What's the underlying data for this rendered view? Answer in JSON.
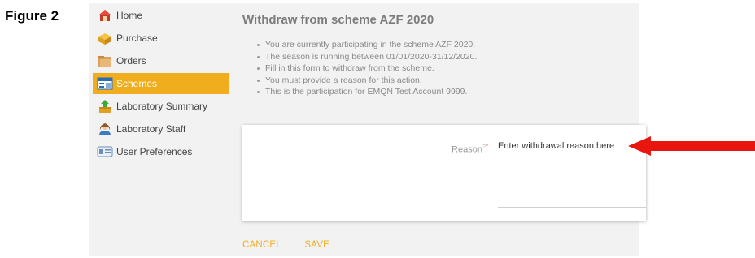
{
  "figure_label": "Figure 2",
  "sidebar": {
    "items": [
      {
        "label": "Home",
        "icon": "home-icon",
        "active": false
      },
      {
        "label": "Purchase",
        "icon": "purchase-box-icon",
        "active": false
      },
      {
        "label": "Orders",
        "icon": "orders-folder-icon",
        "active": false
      },
      {
        "label": "Schemes",
        "icon": "schemes-window-icon",
        "active": true
      },
      {
        "label": "Laboratory Summary",
        "icon": "laboratory-summary-icon",
        "active": false
      },
      {
        "label": "Laboratory Staff",
        "icon": "staff-person-icon",
        "active": false
      },
      {
        "label": "User Preferences",
        "icon": "preferences-card-icon",
        "active": false
      }
    ]
  },
  "main": {
    "title": "Withdraw from scheme AZF 2020",
    "info": [
      "You are currently participating in the scheme AZF 2020.",
      "The season is running between 01/01/2020-31/12/2020.",
      "Fill in this form to withdraw from the scheme.",
      "You must provide a reason for this action.",
      "This is the participation for EMQN Test Account 9999."
    ],
    "form": {
      "reason_label": "Reason",
      "help_mark": "?",
      "required_mark": "*",
      "reason_placeholder": "Enter withdrawal reason here"
    },
    "actions": {
      "cancel_label": "CANCEL",
      "save_label": "SAVE"
    }
  },
  "colors": {
    "accent": "#f0ad1e",
    "panel_bg": "#f2f2f2",
    "arrow": "#e8160f"
  }
}
